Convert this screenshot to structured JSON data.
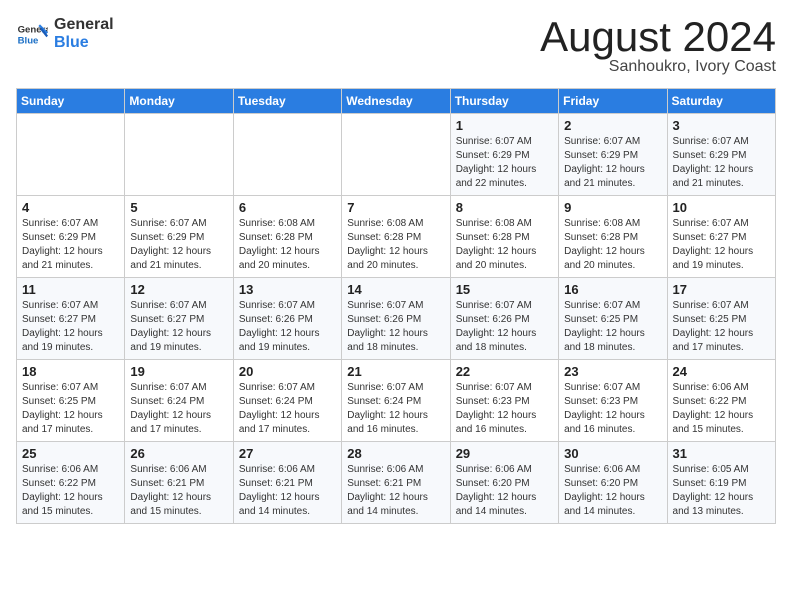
{
  "logo": {
    "line1": "General",
    "line2": "Blue"
  },
  "header": {
    "month": "August 2024",
    "location": "Sanhoukro, Ivory Coast"
  },
  "weekdays": [
    "Sunday",
    "Monday",
    "Tuesday",
    "Wednesday",
    "Thursday",
    "Friday",
    "Saturday"
  ],
  "weeks": [
    [
      {
        "day": "",
        "info": ""
      },
      {
        "day": "",
        "info": ""
      },
      {
        "day": "",
        "info": ""
      },
      {
        "day": "",
        "info": ""
      },
      {
        "day": "1",
        "info": "Sunrise: 6:07 AM\nSunset: 6:29 PM\nDaylight: 12 hours\nand 22 minutes."
      },
      {
        "day": "2",
        "info": "Sunrise: 6:07 AM\nSunset: 6:29 PM\nDaylight: 12 hours\nand 21 minutes."
      },
      {
        "day": "3",
        "info": "Sunrise: 6:07 AM\nSunset: 6:29 PM\nDaylight: 12 hours\nand 21 minutes."
      }
    ],
    [
      {
        "day": "4",
        "info": "Sunrise: 6:07 AM\nSunset: 6:29 PM\nDaylight: 12 hours\nand 21 minutes."
      },
      {
        "day": "5",
        "info": "Sunrise: 6:07 AM\nSunset: 6:29 PM\nDaylight: 12 hours\nand 21 minutes."
      },
      {
        "day": "6",
        "info": "Sunrise: 6:08 AM\nSunset: 6:28 PM\nDaylight: 12 hours\nand 20 minutes."
      },
      {
        "day": "7",
        "info": "Sunrise: 6:08 AM\nSunset: 6:28 PM\nDaylight: 12 hours\nand 20 minutes."
      },
      {
        "day": "8",
        "info": "Sunrise: 6:08 AM\nSunset: 6:28 PM\nDaylight: 12 hours\nand 20 minutes."
      },
      {
        "day": "9",
        "info": "Sunrise: 6:08 AM\nSunset: 6:28 PM\nDaylight: 12 hours\nand 20 minutes."
      },
      {
        "day": "10",
        "info": "Sunrise: 6:07 AM\nSunset: 6:27 PM\nDaylight: 12 hours\nand 19 minutes."
      }
    ],
    [
      {
        "day": "11",
        "info": "Sunrise: 6:07 AM\nSunset: 6:27 PM\nDaylight: 12 hours\nand 19 minutes."
      },
      {
        "day": "12",
        "info": "Sunrise: 6:07 AM\nSunset: 6:27 PM\nDaylight: 12 hours\nand 19 minutes."
      },
      {
        "day": "13",
        "info": "Sunrise: 6:07 AM\nSunset: 6:26 PM\nDaylight: 12 hours\nand 19 minutes."
      },
      {
        "day": "14",
        "info": "Sunrise: 6:07 AM\nSunset: 6:26 PM\nDaylight: 12 hours\nand 18 minutes."
      },
      {
        "day": "15",
        "info": "Sunrise: 6:07 AM\nSunset: 6:26 PM\nDaylight: 12 hours\nand 18 minutes."
      },
      {
        "day": "16",
        "info": "Sunrise: 6:07 AM\nSunset: 6:25 PM\nDaylight: 12 hours\nand 18 minutes."
      },
      {
        "day": "17",
        "info": "Sunrise: 6:07 AM\nSunset: 6:25 PM\nDaylight: 12 hours\nand 17 minutes."
      }
    ],
    [
      {
        "day": "18",
        "info": "Sunrise: 6:07 AM\nSunset: 6:25 PM\nDaylight: 12 hours\nand 17 minutes."
      },
      {
        "day": "19",
        "info": "Sunrise: 6:07 AM\nSunset: 6:24 PM\nDaylight: 12 hours\nand 17 minutes."
      },
      {
        "day": "20",
        "info": "Sunrise: 6:07 AM\nSunset: 6:24 PM\nDaylight: 12 hours\nand 17 minutes."
      },
      {
        "day": "21",
        "info": "Sunrise: 6:07 AM\nSunset: 6:24 PM\nDaylight: 12 hours\nand 16 minutes."
      },
      {
        "day": "22",
        "info": "Sunrise: 6:07 AM\nSunset: 6:23 PM\nDaylight: 12 hours\nand 16 minutes."
      },
      {
        "day": "23",
        "info": "Sunrise: 6:07 AM\nSunset: 6:23 PM\nDaylight: 12 hours\nand 16 minutes."
      },
      {
        "day": "24",
        "info": "Sunrise: 6:06 AM\nSunset: 6:22 PM\nDaylight: 12 hours\nand 15 minutes."
      }
    ],
    [
      {
        "day": "25",
        "info": "Sunrise: 6:06 AM\nSunset: 6:22 PM\nDaylight: 12 hours\nand 15 minutes."
      },
      {
        "day": "26",
        "info": "Sunrise: 6:06 AM\nSunset: 6:21 PM\nDaylight: 12 hours\nand 15 minutes."
      },
      {
        "day": "27",
        "info": "Sunrise: 6:06 AM\nSunset: 6:21 PM\nDaylight: 12 hours\nand 14 minutes."
      },
      {
        "day": "28",
        "info": "Sunrise: 6:06 AM\nSunset: 6:21 PM\nDaylight: 12 hours\nand 14 minutes."
      },
      {
        "day": "29",
        "info": "Sunrise: 6:06 AM\nSunset: 6:20 PM\nDaylight: 12 hours\nand 14 minutes."
      },
      {
        "day": "30",
        "info": "Sunrise: 6:06 AM\nSunset: 6:20 PM\nDaylight: 12 hours\nand 14 minutes."
      },
      {
        "day": "31",
        "info": "Sunrise: 6:05 AM\nSunset: 6:19 PM\nDaylight: 12 hours\nand 13 minutes."
      }
    ]
  ]
}
